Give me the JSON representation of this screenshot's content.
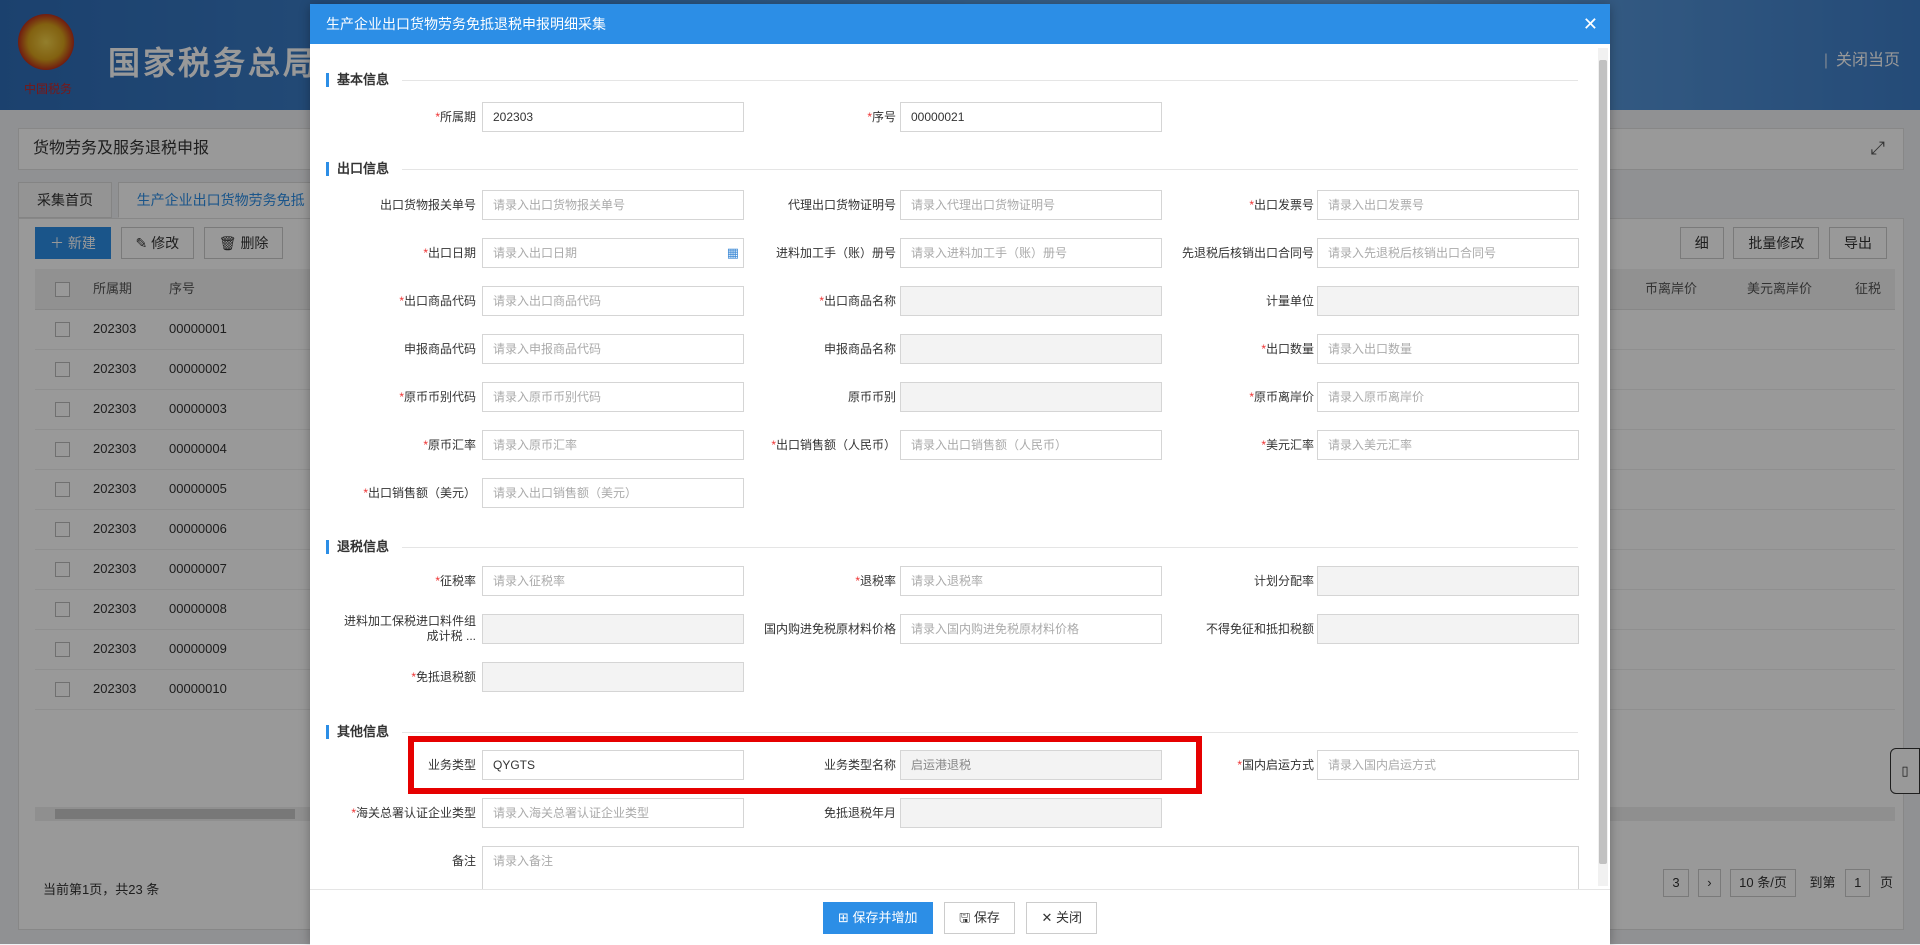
{
  "app": {
    "brand": "国家税务总局",
    "emblem_text": "中国税务",
    "close_page": "关闭当页",
    "breadcrumb": "货物劳务及服务退税申报"
  },
  "tabs": [
    {
      "label": "采集首页"
    },
    {
      "label": "生产企业出口货物劳务免抵"
    }
  ],
  "toolbar": {
    "new": "新建",
    "edit": "修改",
    "delete": "删除",
    "detail": "细",
    "batch_edit": "批量修改",
    "export": "导出"
  },
  "grid": {
    "headers": {
      "period": "所属期",
      "seq": "序号",
      "rmb_price": "币离岸价",
      "usd_price": "美元离岸价",
      "tax": "征税"
    },
    "rows": [
      {
        "period": "202303",
        "seq": "00000001"
      },
      {
        "period": "202303",
        "seq": "00000002"
      },
      {
        "period": "202303",
        "seq": "00000003"
      },
      {
        "period": "202303",
        "seq": "00000004"
      },
      {
        "period": "202303",
        "seq": "00000005"
      },
      {
        "period": "202303",
        "seq": "00000006"
      },
      {
        "period": "202303",
        "seq": "00000007"
      },
      {
        "period": "202303",
        "seq": "00000008"
      },
      {
        "period": "202303",
        "seq": "00000009"
      },
      {
        "period": "202303",
        "seq": "00000010"
      }
    ],
    "footer": "当前第1页，共23 条",
    "pager": {
      "page3": "3",
      "next": "›",
      "size": "10 条/页",
      "goto_label": "到第",
      "goto_value": "1",
      "page_suffix": "页"
    }
  },
  "modal": {
    "title": "生产企业出口货物劳务免抵退税申报明细采集",
    "sections": {
      "basic": "基本信息",
      "export": "出口信息",
      "refund": "退税信息",
      "other": "其他信息"
    },
    "fields": {
      "period_label": "所属期",
      "period_value": "202303",
      "seq_label": "序号",
      "seq_value": "00000021",
      "decl_no_label": "出口货物报关单号",
      "decl_no_ph": "请录入出口货物报关单号",
      "agent_cert_label": "代理出口货物证明号",
      "agent_cert_ph": "请录入代理出口货物证明号",
      "invoice_label": "出口发票号",
      "invoice_ph": "请录入出口发票号",
      "date_label": "出口日期",
      "date_ph": "请录入出口日期",
      "manual_label": "进料加工手（账）册号",
      "manual_ph": "请录入进料加工手（账）册号",
      "contract_label": "先退税后核销出口合同号",
      "contract_ph": "请录入先退税后核销出口合同号",
      "goods_code_label": "出口商品代码",
      "goods_code_ph": "请录入出口商品代码",
      "goods_name_label": "出口商品名称",
      "unit_label": "计量单位",
      "decl_code_label": "申报商品代码",
      "decl_code_ph": "请录入申报商品代码",
      "decl_name_label": "申报商品名称",
      "qty_label": "出口数量",
      "qty_ph": "请录入出口数量",
      "cur_code_label": "原币币别代码",
      "cur_code_ph": "请录入原币币别代码",
      "cur_label": "原币币别",
      "fob_label": "原币离岸价",
      "fob_ph": "请录入原币离岸价",
      "rate_label": "原币汇率",
      "rate_ph": "请录入原币汇率",
      "sales_rmb_label": "出口销售额（人民币）",
      "sales_rmb_ph": "请录入出口销售额（人民币）",
      "usd_rate_label": "美元汇率",
      "usd_rate_ph": "请录入美元汇率",
      "sales_usd_label": "出口销售额（美元）",
      "sales_usd_ph": "请录入出口销售额（美元）",
      "levy_label": "征税率",
      "levy_ph": "请录入征税率",
      "refund_label": "退税率",
      "refund_ph": "请录入退税率",
      "plan_label": "计划分配率",
      "bonded_label": "进料加工保税进口料件组成计税 ...",
      "domestic_label": "国内购进免税原材料价格",
      "domestic_ph": "请录入国内购进免税原材料价格",
      "nodeduct_label": "不得免征和抵扣税额",
      "exempt_label": "免抵退税额",
      "biztype_label": "业务类型",
      "biztype_value": "QYGTS",
      "bizname_label": "业务类型名称",
      "bizname_value": "启运港退税",
      "ship_label": "国内启运方式",
      "ship_ph": "请录入国内启运方式",
      "customs_label": "海关总署认证企业类型",
      "customs_ph": "请录入海关总署认证企业类型",
      "ym_label": "免抵退税年月",
      "note_label": "备注",
      "note_ph": "请录入备注"
    },
    "buttons": {
      "save_add": "保存并增加",
      "save": "保存",
      "close": "关闭"
    },
    "highlight_color": "#e60000",
    "accent_color": "#2c8ee6"
  }
}
